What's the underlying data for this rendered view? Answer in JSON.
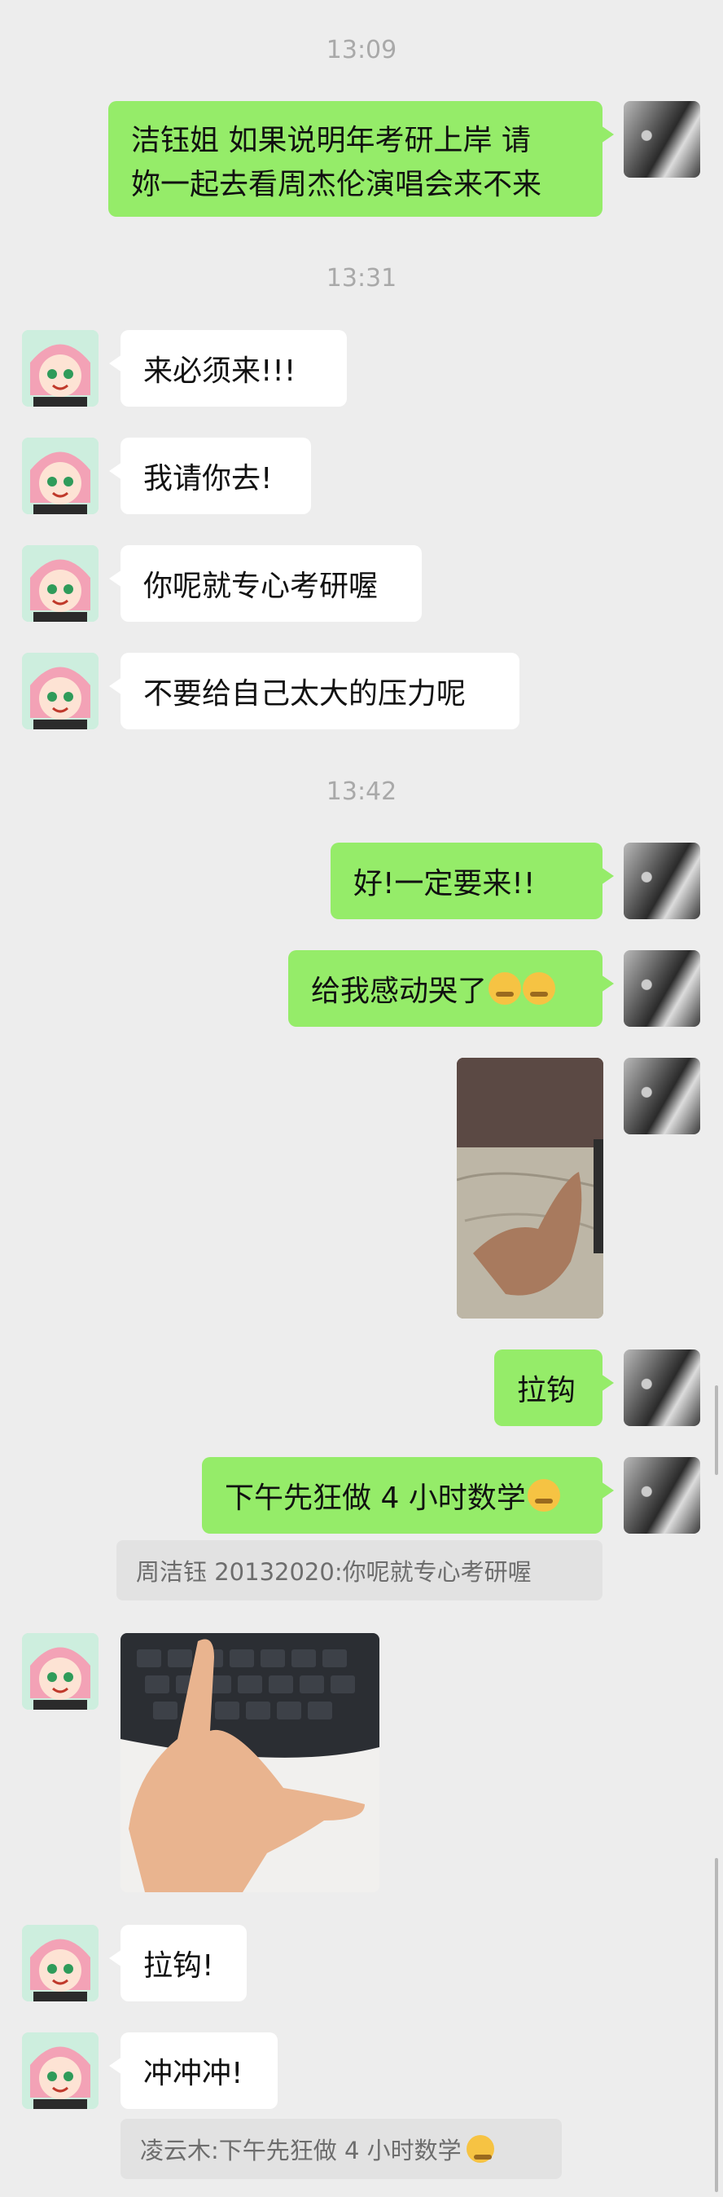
{
  "timestamps": [
    "13:09",
    "13:31",
    "13:42"
  ],
  "messages": {
    "m1": "洁钰姐 如果说明年考研上岸 请\n妳一起去看周杰伦演唱会来不来",
    "m2": "来必须来!!!",
    "m3": "我请你去!",
    "m4": "你呢就专心考研喔",
    "m5": "不要给自己太大的压力呢",
    "m6": "好!一定要来!!",
    "m7": "给我感动哭了",
    "m8": "拉钩",
    "m9": "下午先狂做 4 小时数学",
    "m10": "拉钩!",
    "m11": "冲冲冲!"
  },
  "quotes": {
    "q1": "周洁钰 20132020:你呢就专心考研喔",
    "q2": "凌云木:下午先狂做 4 小时数学"
  },
  "icons": {
    "me_avatar": "user-avatar-icon",
    "them_avatar": "contact-avatar-icon",
    "crying": "crying-face-emoji",
    "headband": "headband-face-emoji"
  },
  "colors": {
    "background": "#ededed",
    "outgoing_bubble": "#95ec69",
    "incoming_bubble": "#ffffff",
    "quote_bg": "#e2e2e2",
    "timestamp": "#a9a9a9"
  }
}
